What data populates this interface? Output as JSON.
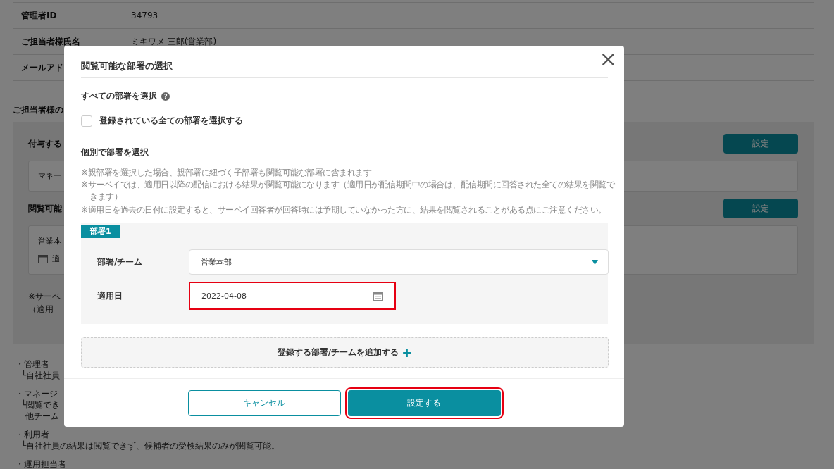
{
  "profile_rows": [
    {
      "label": "管理者ID",
      "value": "34793"
    },
    {
      "label": "ご担当者様氏名",
      "value": "ミキワメ 三郎(営業部)"
    },
    {
      "label": "メールアド",
      "value": ""
    }
  ],
  "settings_heading": "ご担当者様の",
  "settings_panel": {
    "sections": [
      {
        "label": "付与する",
        "button": "設定",
        "kind": "role",
        "box_text": "マネー"
      },
      {
        "label": "閲覧可能",
        "button": "設定",
        "kind": "departments",
        "box_text": "営業本",
        "date_text": "適"
      }
    ],
    "notes": [
      "※サーベ",
      "（適用"
    ]
  },
  "role_notes": [
    {
      "title": "・管理者",
      "lines": [
        "└自社社員"
      ]
    },
    {
      "title": "・マネージ",
      "lines": [
        "└閲覧でき",
        "他チーム"
      ]
    },
    {
      "title": "・利用者",
      "lines": [
        "└自社社員の結果は閲覧できず、候補者の受検結果のみが閲覧可能。"
      ]
    },
    {
      "title": "・運用担当者"
    }
  ],
  "dialog": {
    "title": "閲覧可能な部署の選択",
    "close": "×",
    "select_all": {
      "heading": "すべての部署を選択",
      "help": "?",
      "checkbox_label": "登録されている全ての部署を選択する",
      "checked": false
    },
    "individual_heading": "個別で部署を選択",
    "notes": [
      "※親部署を選択した場合、親部署に紐づく子部署も閲覧可能な部署に含まれます",
      "※サーベイでは、適用日以降の配信における結果が閲覧可能になります（適用日が配信期間中の場合は、配信期間に回答された全ての結果を閲覧できます）",
      "※適用日を過去の日付に設定すると、サーベイ回答者が回答時には予期していなかった方に、結果を閲覧されることがある点にご注意ください。"
    ],
    "departments": [
      {
        "tag": "部署1",
        "department_label": "部署/チーム",
        "department_value": "営業本部",
        "date_label": "適用日",
        "date_value": "2022-04-08",
        "date_highlighted": true
      }
    ],
    "add_button": "登録する部署/チームを追加する",
    "add_icon": "+",
    "buttons": [
      {
        "label": "キャンセル",
        "kind": "secondary",
        "highlighted": false
      },
      {
        "label": "設定する",
        "kind": "primary",
        "highlighted": true
      }
    ]
  }
}
